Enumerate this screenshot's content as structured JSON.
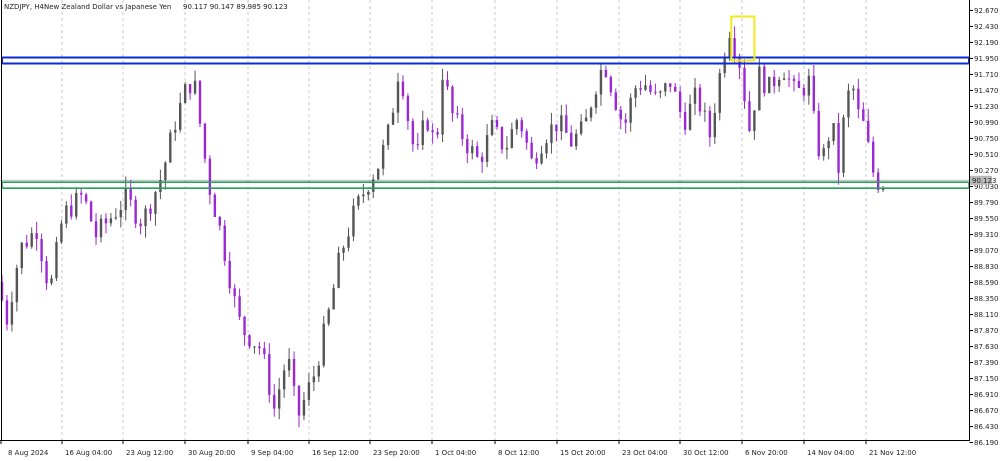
{
  "header": {
    "symbol": "NZDJPY, H4:",
    "description": "New Zealand Dollar vs Japanese Yen",
    "ohlc": "90.117 90.147 89.985 90.123"
  },
  "chart_data": {
    "type": "candlestick",
    "title": "",
    "xlabel": "",
    "ylabel": "",
    "ylim": [
      85.99,
      92.79
    ],
    "grid": "vertical dashed",
    "y_ticks": [
      "92.670",
      "92.430",
      "92.190",
      "91.950",
      "91.710",
      "91.470",
      "91.230",
      "90.990",
      "90.750",
      "90.510",
      "90.270",
      "90.030",
      "89.790",
      "89.550",
      "89.310",
      "89.070",
      "88.830",
      "88.590",
      "88.350",
      "88.110",
      "87.870",
      "87.630",
      "87.390",
      "87.150",
      "86.910",
      "86.670",
      "86.430",
      "86.190"
    ],
    "x_ticks": [
      "8 Aug 2024",
      "16 Aug 04:00",
      "23 Aug 12:00",
      "30 Aug 20:00",
      "9 Sep 04:00",
      "16 Sep 12:00",
      "23 Sep 20:00",
      "1 Oct 04:00",
      "8 Oct 12:00",
      "15 Oct 20:00",
      "23 Oct 04:00",
      "30 Oct 12:00",
      "6 Nov 20:00",
      "14 Nov 04:00",
      "21 Nov 12:00"
    ],
    "current_price": "90.123",
    "price_path": [
      {
        "t": 0,
        "p": 88.6
      },
      {
        "t": 1.5,
        "p": 88.05
      },
      {
        "t": 3.5,
        "p": 89.1
      },
      {
        "t": 6,
        "p": 89.4
      },
      {
        "t": 8,
        "p": 88.45
      },
      {
        "t": 10,
        "p": 89.6
      },
      {
        "t": 13,
        "p": 89.9
      },
      {
        "t": 15,
        "p": 89.3
      },
      {
        "t": 17.5,
        "p": 89.6
      },
      {
        "t": 19.5,
        "p": 89.85
      },
      {
        "t": 22,
        "p": 89.5
      },
      {
        "t": 25,
        "p": 90.2
      },
      {
        "t": 27,
        "p": 91.0
      },
      {
        "t": 29,
        "p": 91.6
      },
      {
        "t": 30,
        "p": 91.5
      },
      {
        "t": 32,
        "p": 90.1
      },
      {
        "t": 34,
        "p": 89.3
      },
      {
        "t": 36,
        "p": 88.3
      },
      {
        "t": 37,
        "p": 87.9
      },
      {
        "t": 40,
        "p": 87.6
      },
      {
        "t": 42,
        "p": 86.7
      },
      {
        "t": 44,
        "p": 87.5
      },
      {
        "t": 45.5,
        "p": 86.55
      },
      {
        "t": 48,
        "p": 87.2
      },
      {
        "t": 50,
        "p": 88.0
      },
      {
        "t": 52,
        "p": 89.0
      },
      {
        "t": 54,
        "p": 89.6
      },
      {
        "t": 56,
        "p": 90.05
      },
      {
        "t": 58,
        "p": 90.4
      },
      {
        "t": 59.5,
        "p": 90.9
      },
      {
        "t": 61,
        "p": 91.9
      },
      {
        "t": 62,
        "p": 91.2
      },
      {
        "t": 63.5,
        "p": 90.4
      },
      {
        "t": 65,
        "p": 91.1
      },
      {
        "t": 66.5,
        "p": 90.6
      },
      {
        "t": 67.5,
        "p": 91.75
      },
      {
        "t": 69,
        "p": 91.1
      },
      {
        "t": 71,
        "p": 90.7
      },
      {
        "t": 73,
        "p": 90.4
      },
      {
        "t": 75,
        "p": 90.9
      },
      {
        "t": 77,
        "p": 90.6
      },
      {
        "t": 79,
        "p": 91.1
      },
      {
        "t": 81,
        "p": 90.4
      },
      {
        "t": 83,
        "p": 90.8
      },
      {
        "t": 85,
        "p": 91.0
      },
      {
        "t": 87,
        "p": 90.7
      },
      {
        "t": 89,
        "p": 90.9
      },
      {
        "t": 90.5,
        "p": 91.5
      },
      {
        "t": 92,
        "p": 91.9
      },
      {
        "t": 93.5,
        "p": 91.4
      },
      {
        "t": 95,
        "p": 90.9
      },
      {
        "t": 96.5,
        "p": 91.5
      },
      {
        "t": 98,
        "p": 91.6
      },
      {
        "t": 100,
        "p": 91.3
      },
      {
        "t": 102,
        "p": 91.6
      },
      {
        "t": 104,
        "p": 91.0
      },
      {
        "t": 106,
        "p": 91.4
      },
      {
        "t": 108,
        "p": 90.8
      },
      {
        "t": 110,
        "p": 92.0
      },
      {
        "t": 111,
        "p": 92.4
      },
      {
        "t": 112.5,
        "p": 91.9
      },
      {
        "t": 114,
        "p": 90.9
      },
      {
        "t": 115.5,
        "p": 91.7
      },
      {
        "t": 117,
        "p": 91.5
      },
      {
        "t": 119,
        "p": 91.85
      },
      {
        "t": 121,
        "p": 91.4
      },
      {
        "t": 123,
        "p": 91.6
      },
      {
        "t": 124,
        "p": 90.8
      },
      {
        "t": 125,
        "p": 90.4
      },
      {
        "t": 126.5,
        "p": 91.0
      },
      {
        "t": 127.5,
        "p": 90.3
      },
      {
        "t": 128.5,
        "p": 91.2
      },
      {
        "t": 129.5,
        "p": 91.6
      },
      {
        "t": 130.5,
        "p": 91.1
      },
      {
        "t": 131.5,
        "p": 90.9
      },
      {
        "t": 132.5,
        "p": 90.3
      },
      {
        "t": 133.5,
        "p": 90.1
      }
    ],
    "annotations": [
      {
        "type": "horizontal-band",
        "color": "#0a2bd8",
        "price": 91.92
      },
      {
        "type": "horizontal-band",
        "color": "#27a05a",
        "price": 90.05
      },
      {
        "type": "rectangle",
        "color": "#f2ea1a",
        "x_range": [
          110.5,
          114
        ],
        "price_range": [
          91.92,
          92.58
        ]
      }
    ]
  },
  "colors": {
    "bull": "#555555",
    "bear": "#9b28d4",
    "resistance": "#0a2bd8",
    "support": "#27a05a",
    "highlight": "#f2ea1a",
    "grid": "#c8c8c8"
  }
}
